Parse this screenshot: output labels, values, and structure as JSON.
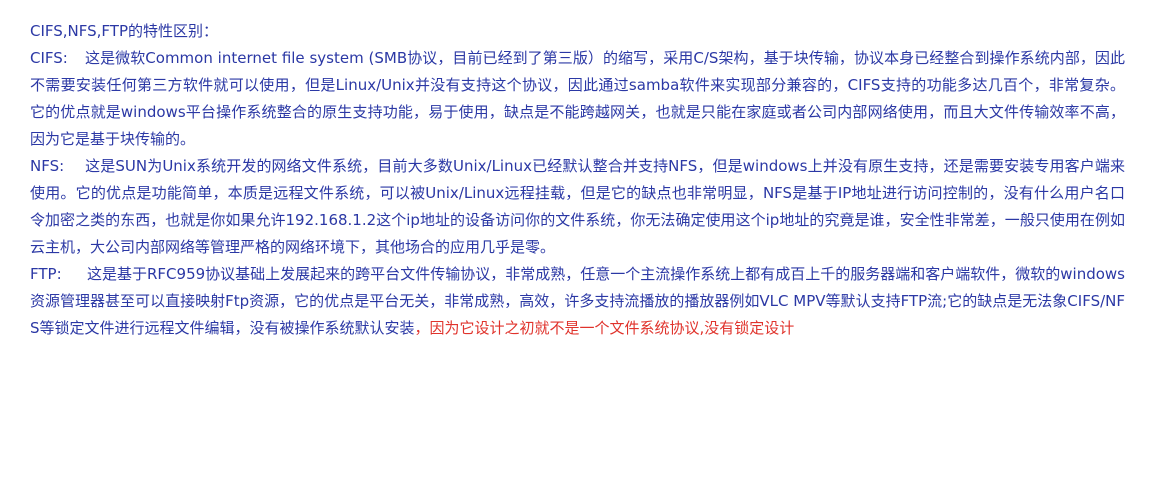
{
  "title": "CIFS,NFS,FTP的特性区别：",
  "colors": {
    "text": "#2b38a5",
    "highlight": "#e0332c",
    "background": "#ffffff"
  },
  "sections": [
    {
      "label": "CIFS:",
      "text": "这是微软Common internet file system (SMB协议，目前已经到了第三版）的缩写，采用C/S架构，基于块传输，协议本身已经整合到操作系统内部，因此不需要安装任何第三方软件就可以使用，但是Linux/Unix并没有支持这个协议，因此通过samba软件来实现部分兼容的，CIFS支持的功能多达几百个，非常复杂。 它的优点就是windows平台操作系统整合的原生支持功能，易于使用，缺点是不能跨越网关，也就是只能在家庭或者公司内部网络使用，而且大文件传输效率不高，因为它是基于块传输的。"
    },
    {
      "label": "NFS:",
      "text": "这是SUN为Unix系统开发的网络文件系统，目前大多数Unix/Linux已经默认整合并支持NFS，但是windows上并没有原生支持，还是需要安装专用客户端来使用。它的优点是功能简单，本质是远程文件系统，可以被Unix/Linux远程挂载，但是它的缺点也非常明显，NFS是基于IP地址进行访问控制的，没有什么用户名口令加密之类的东西，也就是你如果允许192.168.1.2这个ip地址的设备访问你的文件系统，你无法确定使用这个ip地址的究竟是谁，安全性非常差，一般只使用在例如云主机，大公司内部网络等管理严格的网络环境下，其他场合的应用几乎是零。"
    },
    {
      "label": "FTP:",
      "text": "这是基于RFC959协议基础上发展起来的跨平台文件传输协议，非常成熟，任意一个主流操作系统上都有成百上千的服务器端和客户端软件，微软的windows资源管理器甚至可以直接映射Ftp资源，它的优点是平台无关，非常成熟，高效，许多支持流播放的播放器例如VLC MPV等默认支持FTP流;它的缺点是无法象CIFS/NFS等锁定文件进行远程文件编辑，没有被操作系统默认安装",
      "highlight": "，因为它设计之初就不是一个文件系统协议,没有锁定设计"
    }
  ]
}
